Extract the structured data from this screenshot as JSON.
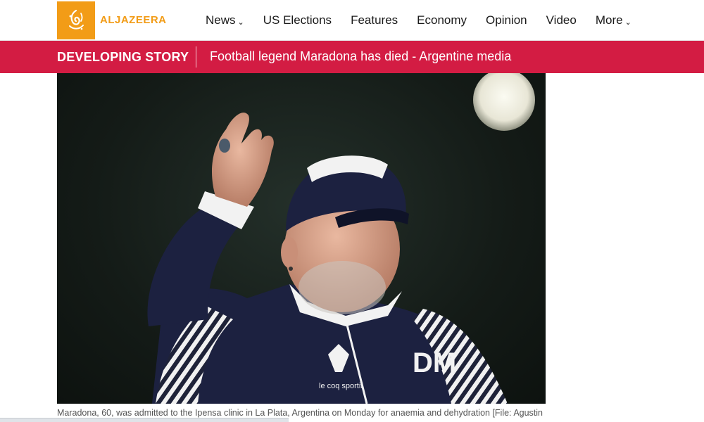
{
  "header": {
    "logo_text": "ALJAZEERA",
    "logo_icon": "aljazeera-calligraphy-logo",
    "brand_color": "#f29c17",
    "nav": [
      {
        "label": "News",
        "has_dropdown": true
      },
      {
        "label": "US Elections",
        "has_dropdown": false
      },
      {
        "label": "Features",
        "has_dropdown": false
      },
      {
        "label": "Economy",
        "has_dropdown": false
      },
      {
        "label": "Opinion",
        "has_dropdown": false
      },
      {
        "label": "Video",
        "has_dropdown": false
      },
      {
        "label": "More",
        "has_dropdown": true
      }
    ]
  },
  "banner": {
    "tag": "DEVELOPING STORY",
    "headline": "Football legend Maradona has died - Argentine media",
    "color": "#d31c43"
  },
  "article": {
    "photo_icon": "maradona-waving-photo",
    "caption": "Maradona, 60, was admitted to the Ipensa clinic in La Plata, Argentina on Monday for anaemia and dehydration [File: Agustin"
  }
}
